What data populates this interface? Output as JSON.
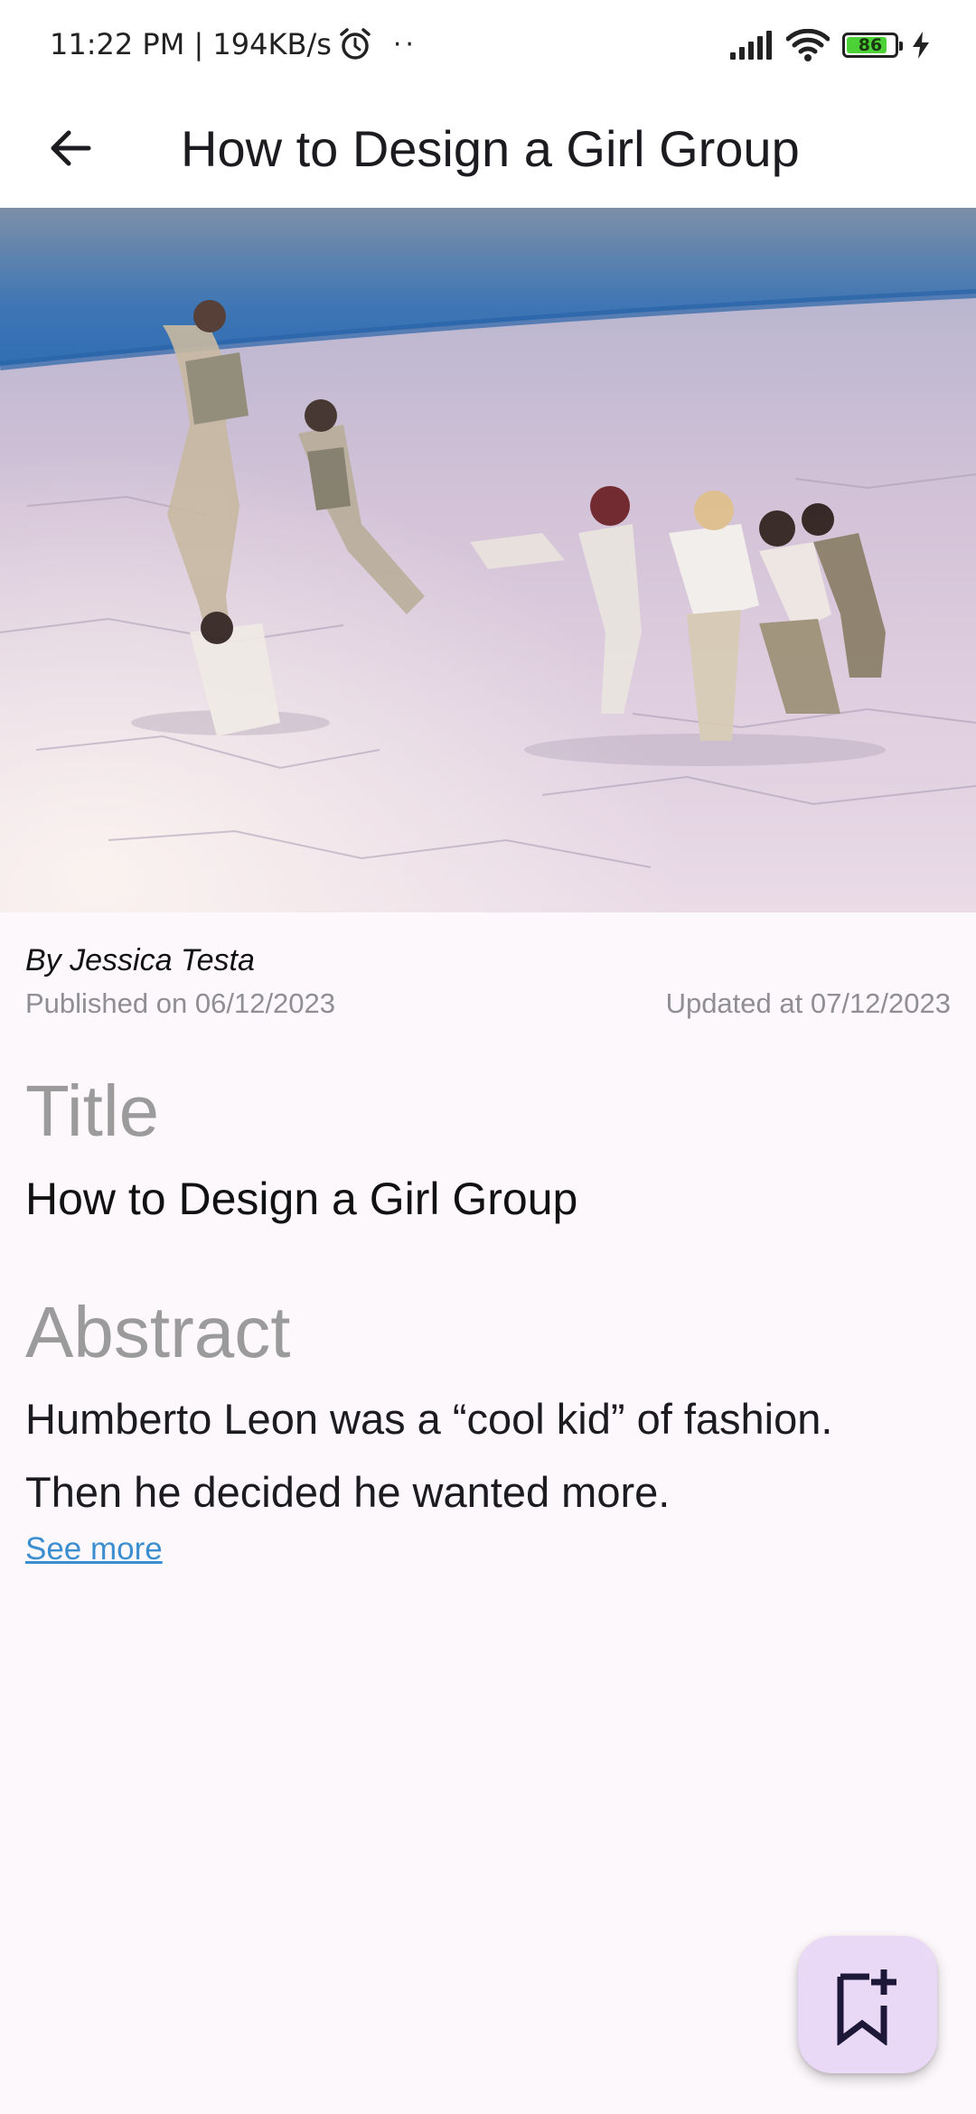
{
  "status_bar": {
    "time_and_speed": "11:22 PM | 194KB/s",
    "more_dots": "··",
    "battery_level": "86",
    "battery_fraction": 0.86,
    "battery_color": "#4cd137",
    "icons": [
      "alarm-icon",
      "signal-icon",
      "wifi-icon",
      "battery-icon",
      "charging-icon"
    ]
  },
  "app_bar": {
    "back_icon": "arrow-back-icon",
    "title": "How to Design a Girl Group"
  },
  "article": {
    "author": "By Jessica Testa",
    "published": "Published on 06/12/2023",
    "updated": "Updated at 07/12/2023",
    "title_label": "Title",
    "title": "How to Design a Girl Group",
    "abstract_label": "Abstract",
    "abstract": "Humberto Leon was a “cool kid” of fashion. Then he decided he wanted more.",
    "see_more": "See more",
    "link_color": "#3b8fd0"
  },
  "fab": {
    "icon": "bookmark-add-icon",
    "background": "#ead8f7"
  }
}
